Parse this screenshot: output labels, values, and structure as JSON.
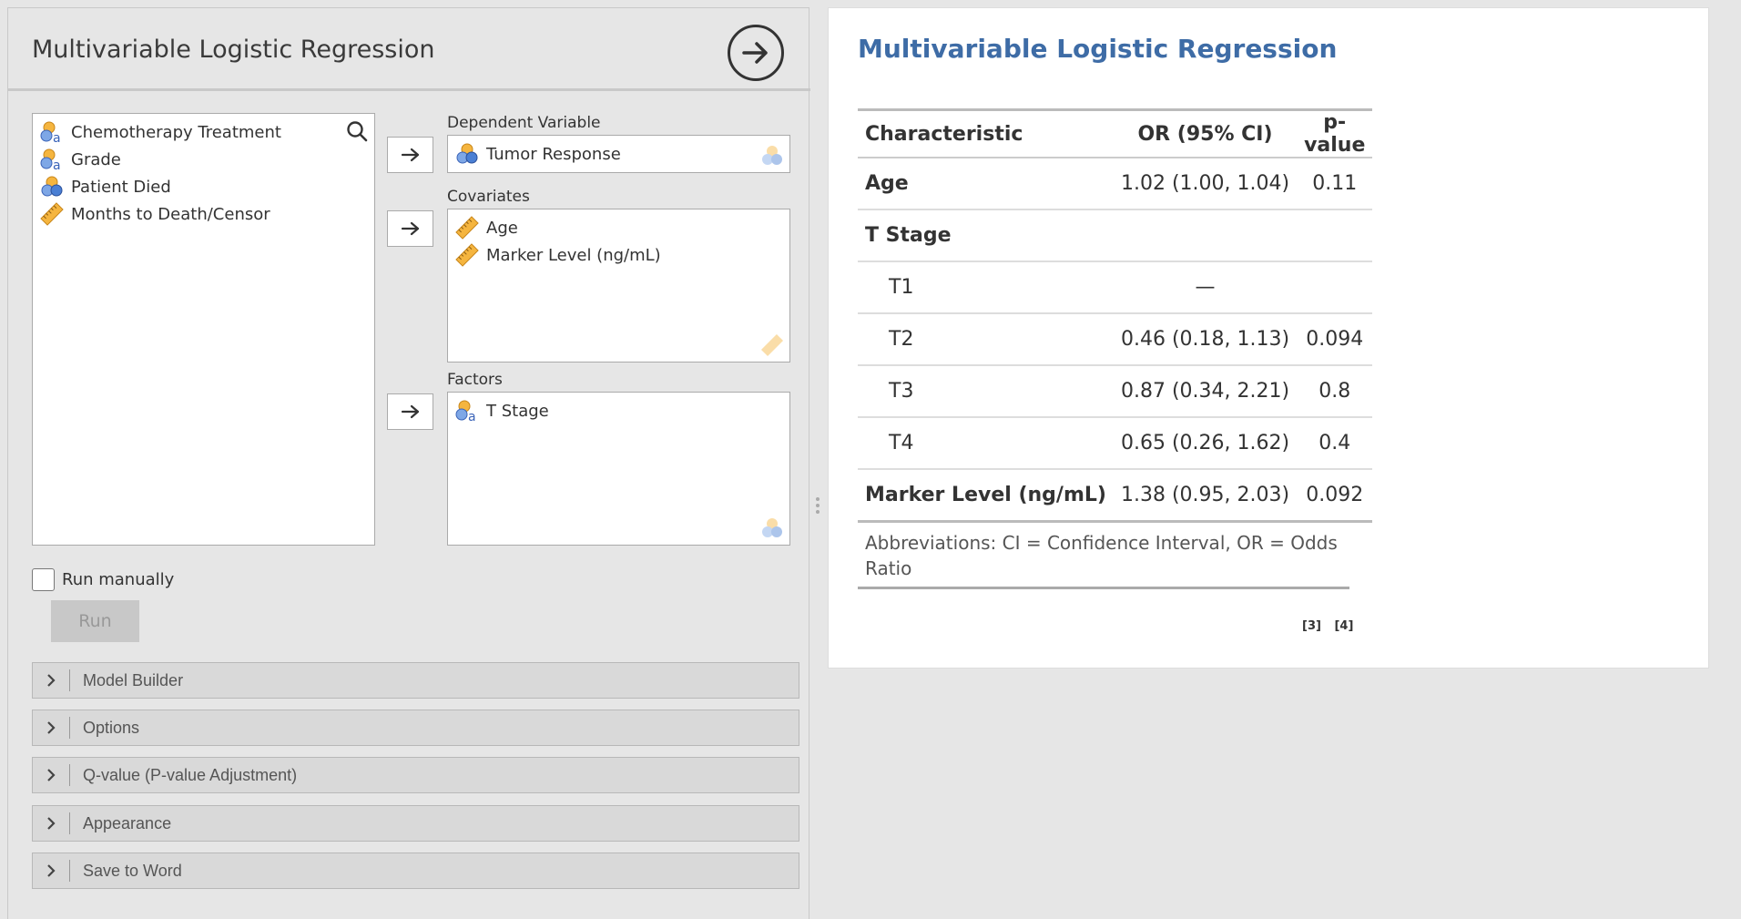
{
  "options_panel": {
    "title": "Multivariable Logistic Regression",
    "variables": [
      {
        "label": "Chemotherapy Treatment",
        "icon": "nominal-text-icon"
      },
      {
        "label": "Grade",
        "icon": "nominal-text-icon"
      },
      {
        "label": "Patient Died",
        "icon": "nominal-icon"
      },
      {
        "label": "Months to Death/Censor",
        "icon": "continuous-ruler-icon"
      }
    ],
    "dependent": {
      "label": "Dependent Variable",
      "items": [
        {
          "label": "Tumor Response",
          "icon": "nominal-icon"
        }
      ]
    },
    "covariates": {
      "label": "Covariates",
      "items": [
        {
          "label": "Age",
          "icon": "continuous-ruler-icon"
        },
        {
          "label": "Marker Level (ng/mL)",
          "icon": "continuous-ruler-icon"
        }
      ]
    },
    "factors": {
      "label": "Factors",
      "items": [
        {
          "label": "T Stage",
          "icon": "nominal-text-icon"
        }
      ]
    },
    "run_manually_label": "Run manually",
    "run_manually_checked": false,
    "run_button": "Run",
    "sections": [
      "Model Builder",
      "Options",
      "Q-value (P-value Adjustment)",
      "Appearance",
      "Save to Word"
    ]
  },
  "results": {
    "title": "Multivariable Logistic Regression",
    "headers": [
      "Characteristic",
      "OR (95% CI)",
      "p-value"
    ],
    "rows": [
      {
        "characteristic": "Age",
        "or": "1.02 (1.00, 1.04)",
        "p": "0.11",
        "bold": true,
        "indent": false
      },
      {
        "characteristic": "T Stage",
        "or": "",
        "p": "",
        "bold": true,
        "indent": false
      },
      {
        "characteristic": "T1",
        "or": "—",
        "p": "",
        "bold": false,
        "indent": true
      },
      {
        "characteristic": "T2",
        "or": "0.46 (0.18, 1.13)",
        "p": "0.094",
        "bold": false,
        "indent": true
      },
      {
        "characteristic": "T3",
        "or": "0.87 (0.34, 2.21)",
        "p": "0.8",
        "bold": false,
        "indent": true
      },
      {
        "characteristic": "T4",
        "or": "0.65 (0.26, 1.62)",
        "p": "0.4",
        "bold": false,
        "indent": true
      },
      {
        "characteristic": "Marker Level (ng/mL)",
        "or": "1.38 (0.95, 2.03)",
        "p": "0.092",
        "bold": true,
        "indent": false
      }
    ],
    "footnote": "Abbreviations: CI = Confidence Interval, OR = Odds Ratio",
    "references": [
      "[3]",
      "[4]"
    ]
  },
  "colors": {
    "title_blue": "#3e6ca6",
    "panel_bg": "#e6e6e6",
    "nominal_orange": "#f5b53f",
    "nominal_blue": "#4a7fd4"
  }
}
